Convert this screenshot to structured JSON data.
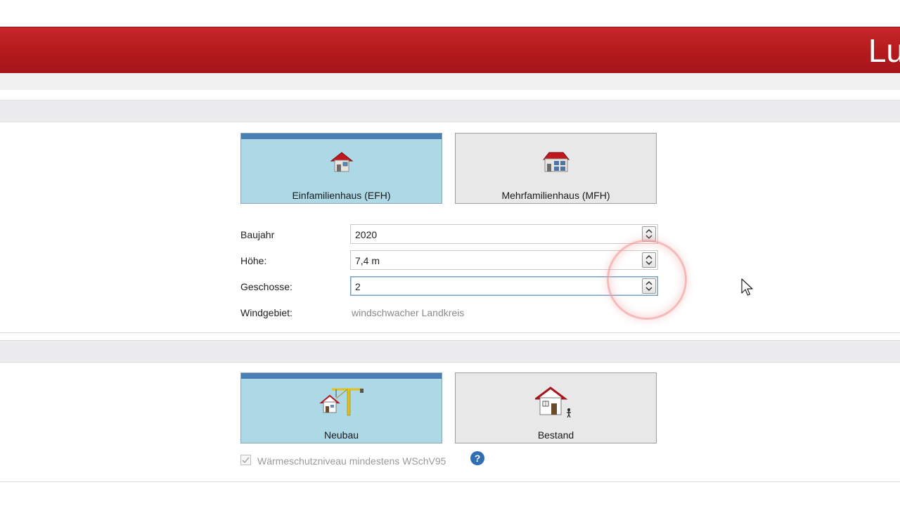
{
  "header": {
    "brand": "Lu"
  },
  "building_type": {
    "options": [
      {
        "label": "Einfamilienhaus (EFH)",
        "icon": "house-icon",
        "selected": true
      },
      {
        "label": "Mehrfamilienhaus (MFH)",
        "icon": "apartment-house-icon",
        "selected": false
      }
    ]
  },
  "form": {
    "baujahr": {
      "label": "Baujahr",
      "value": "2020"
    },
    "hoehe": {
      "label": "Höhe:",
      "value": "7,4 m"
    },
    "geschosse": {
      "label": "Geschosse:",
      "value": "2"
    },
    "windgebiet": {
      "label": "Windgebiet:",
      "value": "windschwacher Landkreis"
    }
  },
  "construction": {
    "options": [
      {
        "label": "Neubau",
        "icon": "crane-house-icon",
        "selected": true
      },
      {
        "label": "Bestand",
        "icon": "existing-house-icon",
        "selected": false
      }
    ],
    "checkbox": {
      "label": "Wärmeschutzniveau mindestens WSchV95",
      "checked": true,
      "disabled": true
    },
    "help": "?"
  },
  "colors": {
    "header_red": "#b3191c",
    "tile_selected": "#add8e6",
    "tile_selected_bar": "#4a7fb5",
    "tile_default": "#e8e8e8",
    "help_blue": "#2f6eb3"
  }
}
